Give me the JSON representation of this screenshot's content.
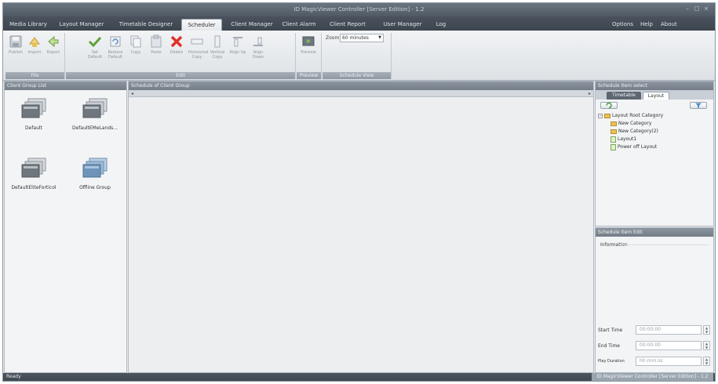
{
  "app": {
    "title": "ID MagicViewer Controller [Server Edition] - 1.2"
  },
  "menu": {
    "tabs": [
      {
        "label": "Media Library"
      },
      {
        "label": "Layout Manager"
      },
      {
        "label": "Timetable Designer"
      },
      {
        "label": "Scheduler"
      },
      {
        "label": "Client Manager"
      },
      {
        "label": "Client Alarm"
      },
      {
        "label": "Client Report"
      },
      {
        "label": "User Manager"
      },
      {
        "label": "Log"
      }
    ],
    "active_tab": "Scheduler",
    "options": "Options",
    "help": "Help",
    "about": "About"
  },
  "ribbon": {
    "file": {
      "label": "File",
      "buttons": [
        {
          "label": "Publish"
        },
        {
          "label": "Import"
        },
        {
          "label": "Export"
        }
      ]
    },
    "edit": {
      "label": "Edit",
      "buttons": [
        {
          "label": "Set Default"
        },
        {
          "label": "Restore Default"
        },
        {
          "label": "Copy"
        },
        {
          "label": "Paste"
        },
        {
          "label": "Delete"
        },
        {
          "label": "Horizontal Copy"
        },
        {
          "label": "Vertical Copy"
        },
        {
          "label": "Align Up"
        },
        {
          "label": "Align Down"
        }
      ]
    },
    "preview": {
      "label": "Preview",
      "buttons": [
        {
          "label": "Preview"
        }
      ]
    },
    "schedule_view": {
      "label": "Schedule View",
      "zoom_label": "Zoom",
      "zoom_value": "60 minutes"
    }
  },
  "client_group_list": {
    "header": "Client Group List",
    "items": [
      {
        "name": "Default"
      },
      {
        "name": "DefaultEMeLands..."
      },
      {
        "name": "DefaultEliteForticol"
      },
      {
        "name": "Offline Group"
      }
    ]
  },
  "schedule": {
    "header": "Schedule of Client Group",
    "left_arrow": "◂",
    "right_arrow": "▸"
  },
  "item_select": {
    "header": "Schedule Item select",
    "tabs": [
      {
        "label": "Timetable"
      },
      {
        "label": "Layout"
      }
    ],
    "tree": {
      "root": "Layout Root Category",
      "children": [
        {
          "label": "New Category"
        },
        {
          "label": "New Category(2)"
        },
        {
          "label": "Layout1"
        },
        {
          "label": "Power off Layout"
        }
      ]
    }
  },
  "item_edit": {
    "header": "Schedule Item Edit",
    "information": "Information",
    "start_time": {
      "label": "Start Time",
      "value": "00:00:00"
    },
    "end_time": {
      "label": "End Time",
      "value": "00:00:00"
    },
    "play_duration": {
      "label": "Play Duration",
      "value": "hh:mm:ss"
    }
  },
  "status": {
    "text": "Ready",
    "right": "ID MagicViewer Controller [Server Edition] - 1.2"
  },
  "colors": {
    "menubar": "#4a535d",
    "ribbon_label": "#98a1ab",
    "panel_header": "#7d868f",
    "accent_red": "#e0312b"
  }
}
